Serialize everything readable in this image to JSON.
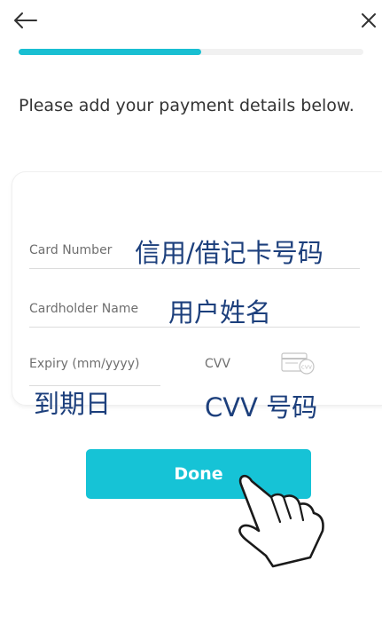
{
  "header": {
    "back_icon": "arrow-left-icon",
    "close_icon": "close-x-icon",
    "progress": 0.53,
    "progress_color": "#19bfd2"
  },
  "intro_text": "Please add your payment details below.",
  "form": {
    "card_number": {
      "placeholder": "Card Number",
      "annotation": "信用/借记卡号码"
    },
    "cardholder_name": {
      "placeholder": "Cardholder Name",
      "annotation": "用户姓名"
    },
    "expiry": {
      "placeholder": "Expiry (mm/yyyy)",
      "annotation": "到期日"
    },
    "cvv": {
      "placeholder": "CVV",
      "icon": "card-cvv-icon",
      "annotation": "CVV 号码"
    }
  },
  "done_button": {
    "label": "Done",
    "color": "#16c3d6"
  },
  "pointer": {
    "icon": "hand-pointer-icon"
  }
}
